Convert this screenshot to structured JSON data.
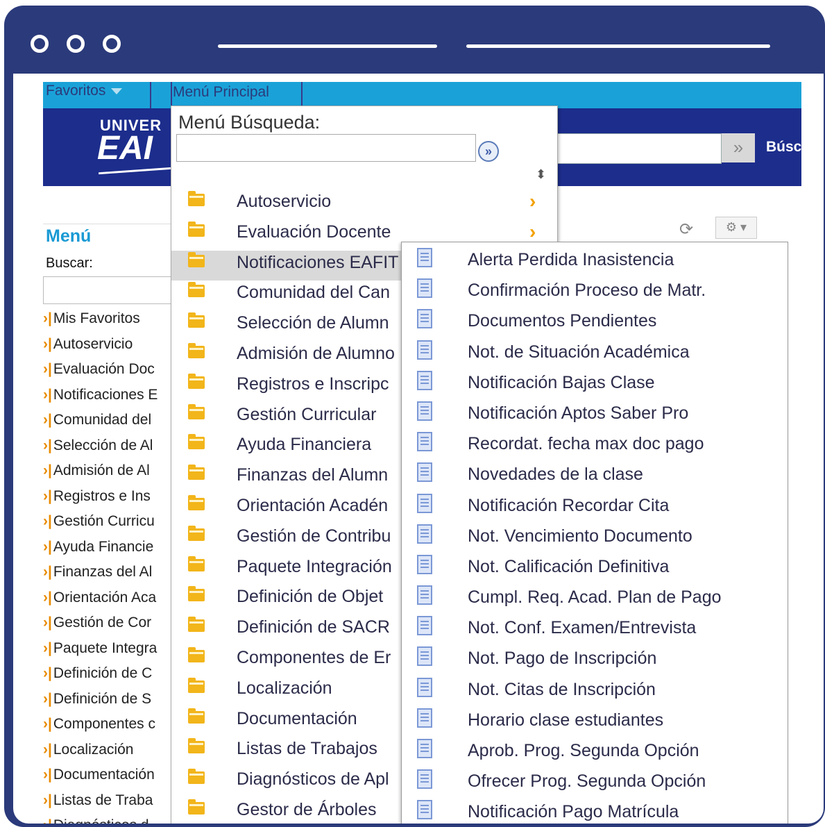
{
  "topbar": {
    "favorites": "Favoritos",
    "main_menu": "Menú Principal"
  },
  "banner": {
    "logo_top": "UNIVER",
    "logo_main": "EAI",
    "search_go": "»",
    "search_label": "Búsc"
  },
  "left_nav": {
    "title": "Menú",
    "search_label": "Buscar:",
    "items": [
      "Mis Favoritos",
      "Autoservicio",
      "Evaluación Doc",
      "Notificaciones E",
      "Comunidad del",
      "Selección de Al",
      "Admisión de Al",
      "Registros e Ins",
      "Gestión Curricu",
      "Ayuda Financie",
      "Finanzas del Al",
      "Orientación Aca",
      "Gestión de Cor",
      "Paquete Integra",
      "Definición de C",
      "Definición de S",
      "Componentes c",
      "Localización",
      "Documentación",
      "Listas de Traba",
      "Diagnósticos d"
    ]
  },
  "dropdown": {
    "search_label": "Menú Búsqueda:",
    "go": "»",
    "items": [
      "Autoservicio",
      "Evaluación Docente",
      "Notificaciones EAFIT",
      "Comunidad del Can",
      "Selección de Alumn",
      "Admisión de Alumno",
      "Registros e Inscripc",
      "Gestión Curricular",
      "Ayuda Financiera",
      "Finanzas del Alumn",
      "Orientación Acadén",
      "Gestión de Contribu",
      "Paquete Integración",
      "Definición de Objet",
      "Definición de SACR",
      "Componentes de Er",
      "Localización",
      "Documentación",
      "Listas de Trabajos",
      "Diagnósticos de Apl",
      "Gestor de Árboles"
    ],
    "selected_index": 2
  },
  "submenu": {
    "items": [
      "Alerta Perdida Inasistencia",
      "Confirmación Proceso de Matr.",
      "Documentos Pendientes",
      "Not. de Situación Académica",
      "Notificación Bajas Clase",
      "Notificación Aptos Saber Pro",
      "Recordat. fecha max doc pago",
      "Novedades de la clase",
      "Notificación Recordar Cita",
      "Not. Vencimiento Documento",
      "Not. Calificación Definitiva",
      "Cumpl. Req. Acad. Plan de Pago",
      "Not. Conf. Examen/Entrevista",
      "Not. Pago de Inscripción",
      "Not. Citas de Inscripción",
      "Horario clase estudiantes",
      "Aprob. Prog. Segunda Opción",
      "Ofrecer Prog. Segunda Opción",
      "Notificación Pago Matrícula"
    ]
  },
  "colors": {
    "frame": "#2b3a7a",
    "topbar": "#1aa2d8",
    "banner": "#1c2d8c",
    "accent": "#f2a100"
  }
}
